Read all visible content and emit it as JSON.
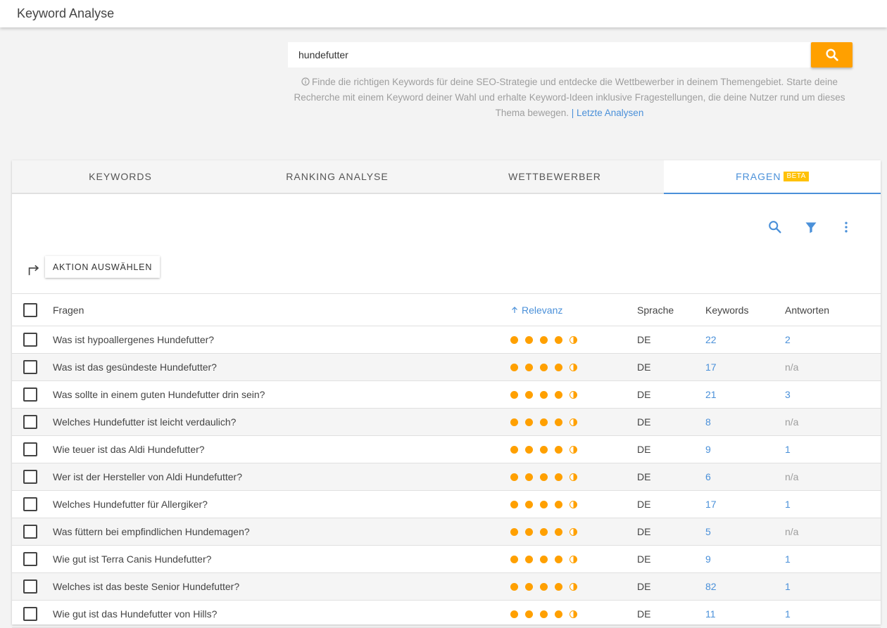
{
  "app": {
    "title": "Keyword Analyse"
  },
  "search": {
    "value": "hundefutter",
    "info_text": "Finde die richtigen Keywords für deine SEO-Strategie und entdecke die Wettbewerber in deinem Themengebiet. Starte deine Recherche mit einem Keyword deiner Wahl und erhalte Keyword-Ideen inklusive Fragestellungen, die deine Nutzer rund um dieses Thema bewegen.",
    "last_link": "| Letzte Analysen"
  },
  "tabs": [
    {
      "label": "KEYWORDS"
    },
    {
      "label": "RANKING ANALYSE"
    },
    {
      "label": "WETTBEWERBER"
    },
    {
      "label": "FRAGEN",
      "badge": "BETA",
      "active": true
    }
  ],
  "toolbar": {
    "action_label": "AKTION AUSWÄHLEN"
  },
  "colors": {
    "accent": "#4a90d9",
    "orange": "#ffa000",
    "badge": "#ffc107"
  },
  "table": {
    "headers": {
      "question": "Fragen",
      "relevance": "Relevanz",
      "language": "Sprache",
      "keywords": "Keywords",
      "answers": "Antworten"
    },
    "rows": [
      {
        "question": "Was ist hypoallergenes Hundefutter?",
        "relevance": 4.5,
        "language": "DE",
        "keywords": "22",
        "answers": "2"
      },
      {
        "question": "Was ist das gesündeste Hundefutter?",
        "relevance": 4.5,
        "language": "DE",
        "keywords": "17",
        "answers": "n/a"
      },
      {
        "question": "Was sollte in einem guten Hundefutter drin sein?",
        "relevance": 4.5,
        "language": "DE",
        "keywords": "21",
        "answers": "3"
      },
      {
        "question": "Welches Hundefutter ist leicht verdaulich?",
        "relevance": 4.5,
        "language": "DE",
        "keywords": "8",
        "answers": "n/a"
      },
      {
        "question": "Wie teuer ist das Aldi Hundefutter?",
        "relevance": 4.5,
        "language": "DE",
        "keywords": "9",
        "answers": "1"
      },
      {
        "question": "Wer ist der Hersteller von Aldi Hundefutter?",
        "relevance": 4.5,
        "language": "DE",
        "keywords": "6",
        "answers": "n/a"
      },
      {
        "question": "Welches Hundefutter für Allergiker?",
        "relevance": 4.5,
        "language": "DE",
        "keywords": "17",
        "answers": "1"
      },
      {
        "question": "Was füttern bei empfindlichen Hundemagen?",
        "relevance": 4.5,
        "language": "DE",
        "keywords": "5",
        "answers": "n/a"
      },
      {
        "question": "Wie gut ist Terra Canis Hundefutter?",
        "relevance": 4.5,
        "language": "DE",
        "keywords": "9",
        "answers": "1"
      },
      {
        "question": "Welches ist das beste Senior Hundefutter?",
        "relevance": 4.5,
        "language": "DE",
        "keywords": "82",
        "answers": "1"
      },
      {
        "question": "Wie gut ist das Hundefutter von Hills?",
        "relevance": 4.5,
        "language": "DE",
        "keywords": "11",
        "answers": "1"
      }
    ]
  }
}
